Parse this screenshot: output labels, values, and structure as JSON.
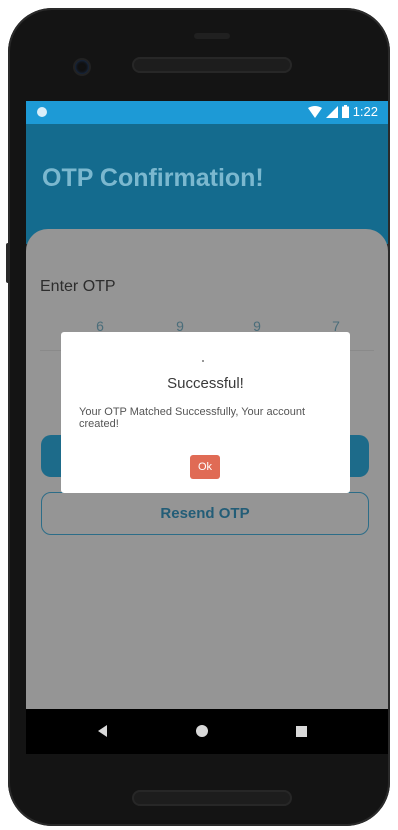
{
  "status_bar": {
    "time": "1:22"
  },
  "app": {
    "title": "OTP Confirmation!",
    "otp_label": "Enter OTP",
    "otp_digits": [
      "6",
      "9",
      "9",
      "7"
    ],
    "resend_label": "Resend OTP"
  },
  "dialog": {
    "title": "Successful!",
    "message": "Your OTP Matched Successfully, Your account created!",
    "ok_label": "Ok"
  },
  "colors": {
    "status_bar": "#1d9ad6",
    "header": "#146b8e",
    "dialog_button": "#e06b55"
  }
}
